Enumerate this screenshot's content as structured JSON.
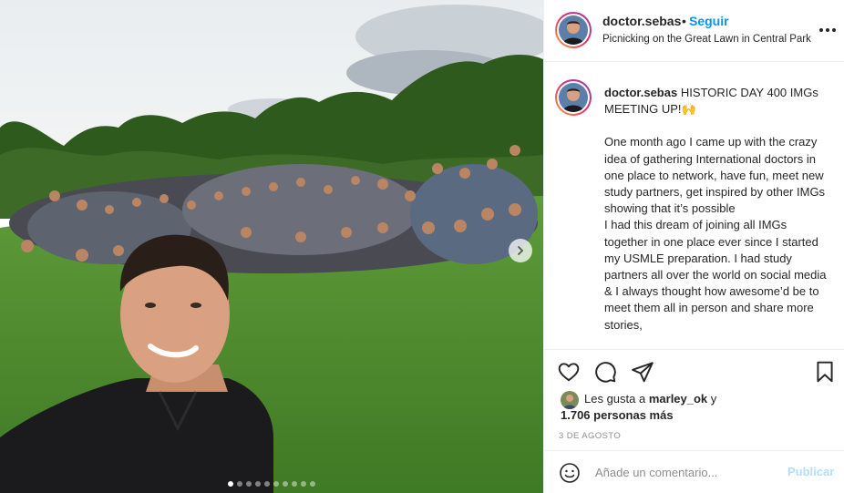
{
  "photo": {
    "alt_icon": "carousel-next-icon",
    "carousel_dots": 10,
    "active_dot": 0
  },
  "header": {
    "username": "doctor.sebas",
    "separator": "•",
    "follow_label": "Seguir",
    "location": "Picnicking on the Great Lawn in Central Park",
    "more_icon": "more-options-icon"
  },
  "caption": {
    "username": "doctor.sebas",
    "title": "HISTORIC DAY 400 IMGs MEETING UP!🙌",
    "paragraph1": "One month ago I came up with the crazy idea of gathering International doctors in one place to network, have fun, meet new study partners, get inspired by other IMGs showing that it’s possible",
    "paragraph2": "I had this dream of joining all IMGs together in one place ever since I started my USMLE preparation. I had study partners all over the world on social media & I always thought how awesome’d be to meet them all in person and share more stories,"
  },
  "actions": {
    "like_icon": "heart-icon",
    "comment_icon": "comment-icon",
    "share_icon": "send-icon",
    "save_icon": "bookmark-icon"
  },
  "likes": {
    "prefix": "Les gusta a",
    "liker": "marley_ok",
    "suffix": "y",
    "count_text": "1.706 personas más"
  },
  "date": "3 DE AGOSTO",
  "comment": {
    "placeholder": "Añade un comentario...",
    "publish_label": "Publicar",
    "emoji_icon": "smiley-icon"
  },
  "colors": {
    "link_blue": "#0095f6",
    "publish_disabled": "#b2dffc",
    "text": "#262626",
    "muted": "#8e8e8e",
    "border": "#efefef"
  }
}
